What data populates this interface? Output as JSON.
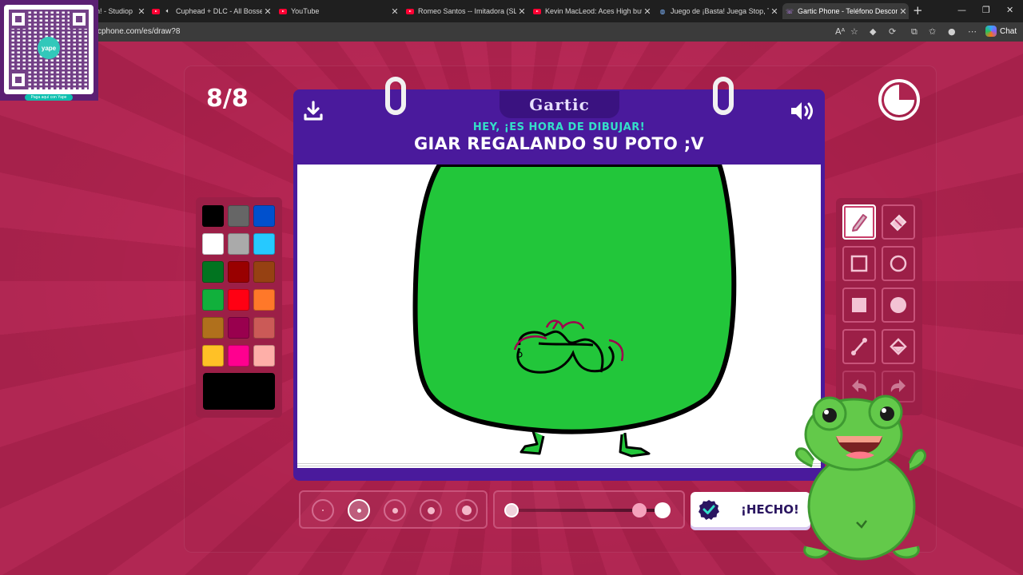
{
  "browser": {
    "tabs": [
      {
        "title": "n! - Studiop",
        "icon": "generic"
      },
      {
        "title": "Cuphead + DLC - All Bosses S",
        "icon": "youtube",
        "muted": true
      },
      {
        "title": "YouTube",
        "icon": "youtube"
      },
      {
        "title": "Romeo Santos -- Imitadora (SLOW",
        "icon": "youtube"
      },
      {
        "title": "Kevin MacLeod: Aces High but lo",
        "icon": "youtube"
      },
      {
        "title": "Juego de ¡Basta! Juega Stop, Tutti",
        "icon": "globe"
      },
      {
        "title": "Gartic Phone - Teléfono Descomp",
        "icon": "gartic",
        "active": true
      }
    ],
    "url": "cphone.com/es/draw?8",
    "chat_label": "Chat"
  },
  "overlay": {
    "qr_brand": "yape",
    "qr_caption": "Paga aquí con Yape"
  },
  "game": {
    "round": "8/8",
    "logo": "Gartic",
    "subtitle": "HEY, ¡ES HORA DE DIBUJAR!",
    "prompt": "GIAR REGALANDO SU POTO ;V",
    "done_label": "¡HECHO!",
    "timer_remaining": 0.75
  },
  "palette": {
    "colors": [
      "#000000",
      "#666666",
      "#0050cd",
      "#ffffff",
      "#aaaaaa",
      "#26c9ff",
      "#017420",
      "#990000",
      "#964112",
      "#11b03c",
      "#ff0013",
      "#ff7829",
      "#b0701c",
      "#99004e",
      "#cb5a57",
      "#ffc126",
      "#ff008f",
      "#feafa8"
    ],
    "selected": "#000000"
  },
  "tools": [
    "pencil-icon",
    "eraser-icon",
    "rectangle-outline-icon",
    "ellipse-outline-icon",
    "rectangle-filled-icon",
    "ellipse-filled-icon",
    "line-icon",
    "fill-bucket-icon",
    "undo-icon",
    "redo-icon"
  ],
  "brush_sizes": {
    "count": 5,
    "selected_index": 1
  },
  "opacity": {
    "value": 1.0
  }
}
